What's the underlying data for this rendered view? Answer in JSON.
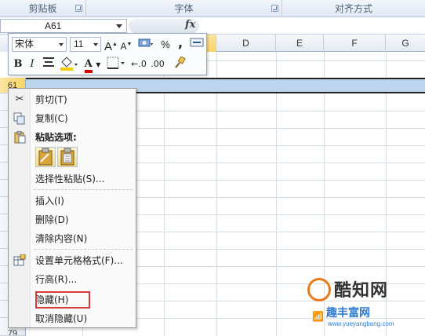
{
  "ribbon": {
    "groups": [
      {
        "label": "剪贴板"
      },
      {
        "label": "字体"
      },
      {
        "label": "对齐方式"
      }
    ]
  },
  "formula_bar": {
    "name_box": "A61",
    "fx_label": "fx"
  },
  "columns": [
    "D",
    "E",
    "F",
    "G"
  ],
  "rows": {
    "selected": "61",
    "bottom": "79"
  },
  "mini_toolbar": {
    "font_name": "宋体",
    "font_size": "11",
    "grow_font": "A",
    "shrink_font": "A",
    "percent": "%",
    "comma": ",",
    "bold": "B",
    "italic": "I",
    "font_color": "A",
    "colors": {
      "fill": "#f5d000",
      "font": "#d40000"
    }
  },
  "context_menu": {
    "items": [
      {
        "label": "剪切(T)",
        "icon": "scissors-icon"
      },
      {
        "label": "复制(C)",
        "icon": "copy-icon"
      },
      {
        "label": "粘贴选项:",
        "icon": "paste-icon"
      },
      {
        "label": "选择性粘贴(S)..."
      },
      {
        "label": "插入(I)"
      },
      {
        "label": "删除(D)"
      },
      {
        "label": "清除内容(N)"
      },
      {
        "label": "设置单元格格式(F)...",
        "icon": "format-cells-icon"
      },
      {
        "label": "行高(R)..."
      },
      {
        "label": "隐藏(H)"
      },
      {
        "label": "取消隐藏(U)"
      }
    ],
    "highlight_color": "#d63a3a"
  },
  "watermark": {
    "title": "酷知网",
    "subtitle": "趣丰富网",
    "url": "www.yueyangbang.com"
  }
}
